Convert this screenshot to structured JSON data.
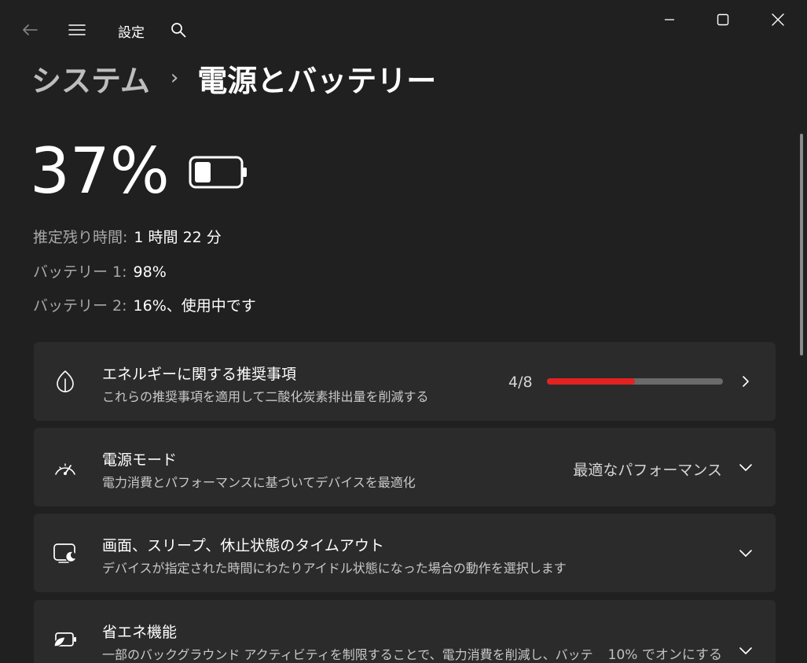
{
  "titlebar": {
    "app_title": "設定"
  },
  "breadcrumb": {
    "parent": "システム",
    "separator": "›",
    "current": "電源とバッテリー"
  },
  "battery": {
    "percent_text": "37%",
    "level_percent": 37,
    "estimated_label": "推定残り時間:",
    "estimated_value": "1 時間 22 分",
    "battery1_label": "バッテリー 1:",
    "battery1_value": "98%",
    "battery2_label": "バッテリー 2:",
    "battery2_value": "16%、使用中です"
  },
  "cards": {
    "energy": {
      "title": "エネルギーに関する推奨事項",
      "desc": "これらの推奨事項を適用して二酸化炭素排出量を削減する",
      "count": "4/8",
      "progress_fraction": 0.5
    },
    "power_mode": {
      "title": "電源モード",
      "desc": "電力消費とパフォーマンスに基づいてデバイスを最適化",
      "value": "最適なパフォーマンス"
    },
    "screen_sleep": {
      "title": "画面、スリープ、休止状態のタイムアウト",
      "desc": "デバイスが指定された時間にわたりアイドル状態になった場合の動作を選択します"
    },
    "energy_saver": {
      "title": "省エネ機能",
      "desc": "一部のバックグラウンド アクティビティを制限することで、電力消費を削減し、バッテ",
      "value": "10% でオンにする"
    }
  },
  "colors": {
    "background": "#202020",
    "card": "#2b2b2b",
    "progress_accent": "#e32222"
  }
}
